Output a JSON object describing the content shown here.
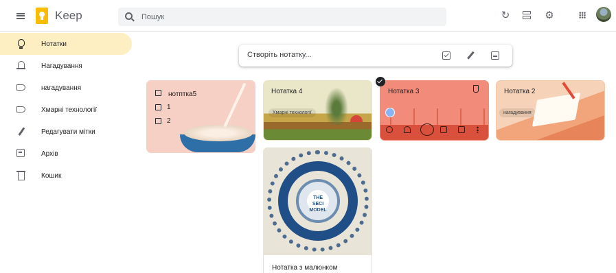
{
  "header": {
    "app_title": "Keep",
    "search_placeholder": "Пошук"
  },
  "sidebar": {
    "items": [
      {
        "label": "Нотатки",
        "icon": "lightbulb-icon",
        "active": true
      },
      {
        "label": "Нагадування",
        "icon": "bell-icon"
      },
      {
        "label": "нагадування",
        "icon": "label-icon"
      },
      {
        "label": "Хмарні технології",
        "icon": "label-icon"
      },
      {
        "label": "Редагувати мітки",
        "icon": "pencil-icon"
      },
      {
        "label": "Архів",
        "icon": "archive-icon"
      },
      {
        "label": "Кошик",
        "icon": "trash-icon"
      }
    ]
  },
  "take_note": {
    "placeholder": "Створіть нотатку..."
  },
  "notes": {
    "n1": {
      "title": "нотптка5",
      "items": [
        "1",
        "2"
      ],
      "color": "#f6d0c4"
    },
    "n4": {
      "title": "Нотатка 4",
      "label": "Хмарні технології"
    },
    "n3": {
      "title": "Нотатка 3",
      "color": "#f28b7a"
    },
    "n2": {
      "title": "Нотатка 2",
      "label": "нагадування"
    },
    "n5": {
      "title": "Нотатка з малюнком",
      "image_text": "THE SECI MODEL"
    }
  },
  "colors": {
    "active_nav": "#feefc3",
    "brand_yellow": "#fbbc04"
  }
}
